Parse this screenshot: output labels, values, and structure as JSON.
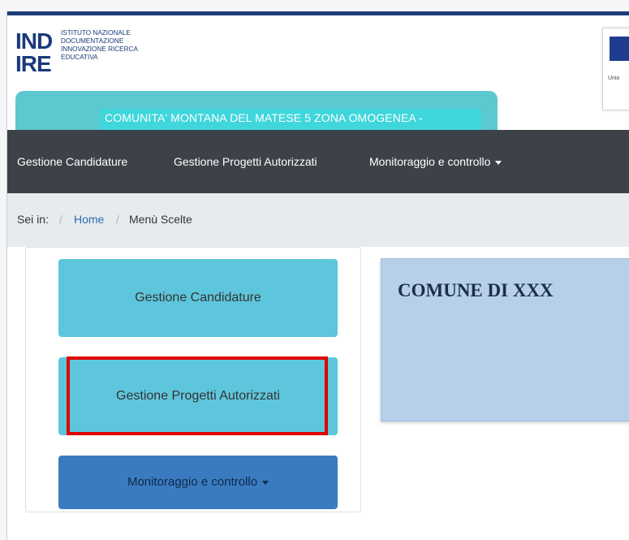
{
  "logo": {
    "line1": "IND",
    "line2": "IRE",
    "subtitle": "ISTITUTO NAZIONALE DOCUMENTAZIONE INNOVAZIONE RICERCA EDUCATIVA"
  },
  "eu": {
    "caption": "Unio"
  },
  "banner": {
    "title": "COMUNITA' MONTANA DEL MATESE 5 ZONA OMOGENEA -"
  },
  "navbar": {
    "items": [
      {
        "label": "Gestione Candidature"
      },
      {
        "label": "Gestione Progetti Autorizzati"
      },
      {
        "label": "Monitoraggio e controllo"
      }
    ]
  },
  "breadcrumb": {
    "prefix": "Sei in:",
    "home": "Home",
    "current": "Menù Scelte"
  },
  "menu": {
    "buttons": [
      {
        "label": "Gestione Candidature"
      },
      {
        "label": "Gestione Progetti Autorizzati"
      },
      {
        "label": "Monitoraggio e controllo"
      }
    ]
  },
  "info": {
    "title": "COMUNE DI XXX"
  },
  "colors": {
    "accent": "#5ec6dc",
    "highlight": "#e00000",
    "navbar": "#3c4248",
    "banner": "#5cc8cf"
  }
}
